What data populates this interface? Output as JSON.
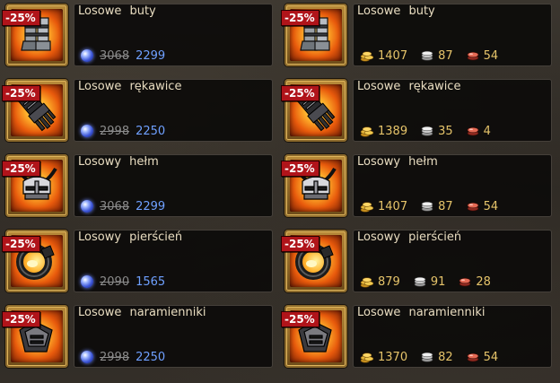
{
  "discount_label": "-25%",
  "colors": {
    "gem_price": "#6fa0ff",
    "resource_value": "#e6c46a",
    "badge_bg": "#b0141a"
  },
  "gem_offers": [
    {
      "name": "Losowe buty",
      "icon": "boots-icon",
      "old_price": "3068",
      "new_price": "2299"
    },
    {
      "name": "Losowe rękawice",
      "icon": "gauntlet-icon",
      "old_price": "2998",
      "new_price": "2250"
    },
    {
      "name": "Losowy hełm",
      "icon": "helmet-icon",
      "old_price": "3068",
      "new_price": "2299"
    },
    {
      "name": "Losowy pierścień",
      "icon": "ring-icon",
      "old_price": "2090",
      "new_price": "1565"
    },
    {
      "name": "Losowe naramienniki",
      "icon": "shoulder-armor-icon",
      "old_price": "2998",
      "new_price": "2250"
    }
  ],
  "resource_offers": [
    {
      "name": "Losowe buty",
      "icon": "boots-icon",
      "gold": "1407",
      "silver": "87",
      "ruby": "54"
    },
    {
      "name": "Losowe rękawice",
      "icon": "gauntlet-icon",
      "gold": "1389",
      "silver": "35",
      "ruby": "4"
    },
    {
      "name": "Losowy hełm",
      "icon": "helmet-icon",
      "gold": "1407",
      "silver": "87",
      "ruby": "54"
    },
    {
      "name": "Losowy pierścień",
      "icon": "ring-icon",
      "gold": "879",
      "silver": "91",
      "ruby": "28"
    },
    {
      "name": "Losowe naramienniki",
      "icon": "shoulder-armor-icon",
      "gold": "1370",
      "silver": "82",
      "ruby": "54"
    }
  ]
}
